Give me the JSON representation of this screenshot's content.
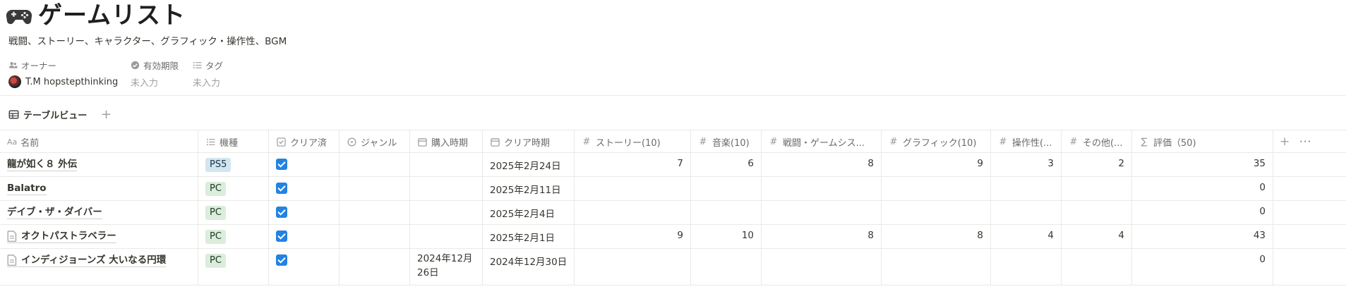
{
  "page": {
    "icon": "game-controller-icon",
    "title": "ゲームリスト",
    "description": "戦闘、ストーリー、キャラクター、グラフィック・操作性、BGM"
  },
  "properties": {
    "owner_label": "オーナー",
    "owner_value": "T.M hopstepthinking",
    "expiry_label": "有効期限",
    "expiry_value": "未入力",
    "tag_label": "タグ",
    "tag_value": "未入力"
  },
  "view": {
    "tab_label": "テーブルビュー",
    "add_symbol": "+"
  },
  "table": {
    "columns": [
      {
        "icon": "Aa",
        "label": "名前"
      },
      {
        "icon": "list-icon",
        "label": "機種"
      },
      {
        "icon": "checkbox-icon",
        "label": "クリア済"
      },
      {
        "icon": "select-icon",
        "label": "ジャンル"
      },
      {
        "icon": "calendar-icon",
        "label": "購入時期"
      },
      {
        "icon": "calendar-icon",
        "label": "クリア時期"
      },
      {
        "icon": "#",
        "label": "ストーリー(10)"
      },
      {
        "icon": "#",
        "label": "音楽(10)"
      },
      {
        "icon": "#",
        "label": "戦闘・ゲームシス..."
      },
      {
        "icon": "#",
        "label": "グラフィック(10)"
      },
      {
        "icon": "#",
        "label": "操作性(..."
      },
      {
        "icon": "#",
        "label": "その他(..."
      },
      {
        "icon": "∑",
        "label": "評価（50)"
      }
    ],
    "add_column": "+",
    "more": "···",
    "rows": [
      {
        "name": "龍が如く８ 外伝",
        "has_page_icon": false,
        "platform": "PS5",
        "cleared": true,
        "genre": "",
        "purchased": "",
        "cleared_date": "2025年2月24日",
        "story": "7",
        "music": "6",
        "battle": "8",
        "graphics": "9",
        "controls": "3",
        "other": "2",
        "score": "35"
      },
      {
        "name": "Balatro",
        "has_page_icon": false,
        "platform": "PC",
        "cleared": true,
        "genre": "",
        "purchased": "",
        "cleared_date": "2025年2月11日",
        "story": "",
        "music": "",
        "battle": "",
        "graphics": "",
        "controls": "",
        "other": "",
        "score": "0"
      },
      {
        "name": "デイブ・ザ・ダイバー",
        "has_page_icon": false,
        "platform": "PC",
        "cleared": true,
        "genre": "",
        "purchased": "",
        "cleared_date": "2025年2月4日",
        "story": "",
        "music": "",
        "battle": "",
        "graphics": "",
        "controls": "",
        "other": "",
        "score": "0"
      },
      {
        "name": "オクトパストラベラー",
        "has_page_icon": true,
        "platform": "PC",
        "cleared": true,
        "genre": "",
        "purchased": "",
        "cleared_date": "2025年2月1日",
        "story": "9",
        "music": "10",
        "battle": "8",
        "graphics": "8",
        "controls": "4",
        "other": "4",
        "score": "43"
      },
      {
        "name": "インディジョーンズ 大いなる円環",
        "has_page_icon": true,
        "platform": "PC",
        "cleared": true,
        "genre": "",
        "purchased": "2024年12月26日",
        "cleared_date": "2024年12月30日",
        "story": "",
        "music": "",
        "battle": "",
        "graphics": "",
        "controls": "",
        "other": "",
        "score": "0"
      }
    ]
  }
}
